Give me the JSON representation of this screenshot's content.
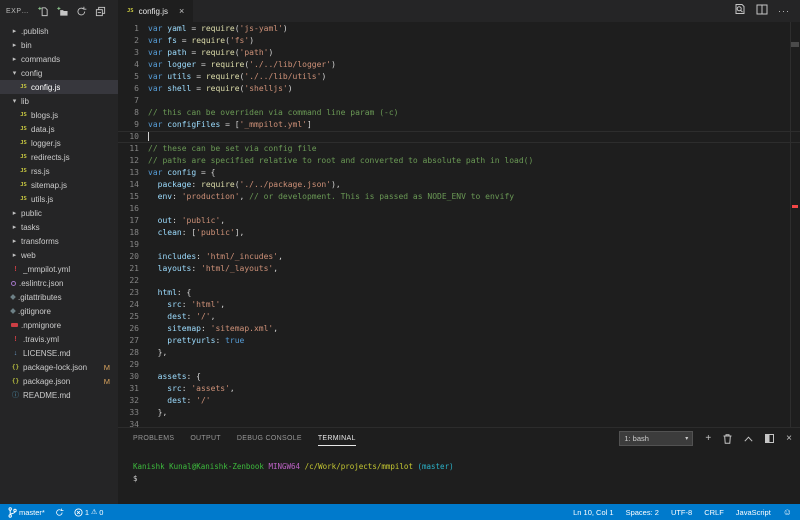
{
  "colors": {
    "accent": "#007acc",
    "editor_bg": "#1e1e1e",
    "sidebar_bg": "#252526",
    "selected_row_bg": "#37373d",
    "keyword": "#569cd6",
    "variable": "#9cdcfe",
    "function": "#dcdcaa",
    "string": "#ce9178",
    "comment": "#6a9955",
    "error_marker": "#f44747",
    "js_icon": "#cbcb41",
    "modified_badge": "#dba55f"
  },
  "explorer": {
    "title": "EXPLORER",
    "toolbar_icons": [
      "new-file-icon",
      "new-folder-icon",
      "refresh-explorer-icon",
      "collapse-folders-icon"
    ],
    "items": [
      {
        "label": ".publish",
        "icon": "folder",
        "arrow": "collapsed",
        "indent": 0
      },
      {
        "label": "bin",
        "icon": "folder",
        "arrow": "collapsed",
        "indent": 0
      },
      {
        "label": "commands",
        "icon": "folder",
        "arrow": "collapsed",
        "indent": 0
      },
      {
        "label": "config",
        "icon": "folder",
        "arrow": "expanded",
        "indent": 0
      },
      {
        "label": "config.js",
        "icon": "js",
        "indent": 1,
        "selected": true
      },
      {
        "label": "lib",
        "icon": "folder",
        "arrow": "expanded",
        "indent": 0
      },
      {
        "label": "blogs.js",
        "icon": "js",
        "indent": 1
      },
      {
        "label": "data.js",
        "icon": "js",
        "indent": 1
      },
      {
        "label": "logger.js",
        "icon": "js",
        "indent": 1
      },
      {
        "label": "redirects.js",
        "icon": "js",
        "indent": 1
      },
      {
        "label": "rss.js",
        "icon": "js",
        "indent": 1
      },
      {
        "label": "sitemap.js",
        "icon": "js",
        "indent": 1
      },
      {
        "label": "utils.js",
        "icon": "js",
        "indent": 1
      },
      {
        "label": "public",
        "icon": "folder",
        "arrow": "collapsed",
        "indent": 0
      },
      {
        "label": "tasks",
        "icon": "folder",
        "arrow": "collapsed",
        "indent": 0
      },
      {
        "label": "transforms",
        "icon": "folder",
        "arrow": "collapsed",
        "indent": 0
      },
      {
        "label": "web",
        "icon": "folder",
        "arrow": "collapsed",
        "indent": 0
      },
      {
        "label": "_mmpilot.yml",
        "icon": "yml",
        "indent": 0
      },
      {
        "label": ".eslintrc.json",
        "icon": "eslint",
        "indent": 0
      },
      {
        "label": ".gitattributes",
        "icon": "git",
        "indent": 0
      },
      {
        "label": ".gitignore",
        "icon": "git",
        "indent": 0
      },
      {
        "label": ".npmignore",
        "icon": "npm",
        "indent": 0
      },
      {
        "label": ".travis.yml",
        "icon": "yml",
        "indent": 0
      },
      {
        "label": "LICENSE.md",
        "icon": "license",
        "indent": 0
      },
      {
        "label": "package-lock.json",
        "icon": "json",
        "indent": 0,
        "badge": "M"
      },
      {
        "label": "package.json",
        "icon": "json",
        "indent": 0,
        "badge": "M"
      },
      {
        "label": "README.md",
        "icon": "info",
        "indent": 0
      }
    ]
  },
  "editor": {
    "tab": {
      "label": "config.js",
      "icon": "js",
      "close_glyph": "×"
    },
    "action_icons": [
      "open-preview-icon",
      "split-editor-icon",
      "more-actions-icon"
    ],
    "cursor": {
      "line": 10,
      "col": 1
    },
    "lines": [
      {
        "n": 1,
        "t": [
          [
            "k",
            "var"
          ],
          [
            "d",
            " "
          ],
          [
            "v",
            "yaml"
          ],
          [
            "d",
            " = "
          ],
          [
            "f",
            "require"
          ],
          [
            "d",
            "("
          ],
          [
            "s",
            "'js-yaml'"
          ],
          [
            "d",
            ")"
          ]
        ]
      },
      {
        "n": 2,
        "t": [
          [
            "k",
            "var"
          ],
          [
            "d",
            " "
          ],
          [
            "v",
            "fs"
          ],
          [
            "d",
            " = "
          ],
          [
            "f",
            "require"
          ],
          [
            "d",
            "("
          ],
          [
            "s",
            "'fs'"
          ],
          [
            "d",
            ")"
          ]
        ]
      },
      {
        "n": 3,
        "t": [
          [
            "k",
            "var"
          ],
          [
            "d",
            " "
          ],
          [
            "v",
            "path"
          ],
          [
            "d",
            " = "
          ],
          [
            "f",
            "require"
          ],
          [
            "d",
            "("
          ],
          [
            "s",
            "'path'"
          ],
          [
            "d",
            ")"
          ]
        ]
      },
      {
        "n": 4,
        "t": [
          [
            "k",
            "var"
          ],
          [
            "d",
            " "
          ],
          [
            "v",
            "logger"
          ],
          [
            "d",
            " = "
          ],
          [
            "f",
            "require"
          ],
          [
            "d",
            "("
          ],
          [
            "s",
            "'./../lib/logger'"
          ],
          [
            "d",
            ")"
          ]
        ]
      },
      {
        "n": 5,
        "t": [
          [
            "k",
            "var"
          ],
          [
            "d",
            " "
          ],
          [
            "v",
            "utils"
          ],
          [
            "d",
            " = "
          ],
          [
            "f",
            "require"
          ],
          [
            "d",
            "("
          ],
          [
            "s",
            "'./../lib/utils'"
          ],
          [
            "d",
            ")"
          ]
        ]
      },
      {
        "n": 6,
        "t": [
          [
            "k",
            "var"
          ],
          [
            "d",
            " "
          ],
          [
            "v",
            "shell"
          ],
          [
            "d",
            " = "
          ],
          [
            "f",
            "require"
          ],
          [
            "d",
            "("
          ],
          [
            "s",
            "'shelljs'"
          ],
          [
            "d",
            ")"
          ]
        ]
      },
      {
        "n": 7,
        "t": []
      },
      {
        "n": 8,
        "t": [
          [
            "c",
            "// this can be overriden via command line param (-c)"
          ]
        ]
      },
      {
        "n": 9,
        "t": [
          [
            "k",
            "var"
          ],
          [
            "d",
            " "
          ],
          [
            "v",
            "configFiles"
          ],
          [
            "d",
            " = ["
          ],
          [
            "s",
            "'_mmpilot.yml'"
          ],
          [
            "d",
            "]"
          ]
        ]
      },
      {
        "n": 10,
        "t": [],
        "cur": true
      },
      {
        "n": 11,
        "t": [
          [
            "c",
            "// these can be set via config file"
          ]
        ]
      },
      {
        "n": 12,
        "t": [
          [
            "c",
            "// paths are specified relative to root and converted to absolute path in load()"
          ]
        ]
      },
      {
        "n": 13,
        "t": [
          [
            "k",
            "var"
          ],
          [
            "d",
            " "
          ],
          [
            "v",
            "config"
          ],
          [
            "d",
            " = {"
          ]
        ]
      },
      {
        "n": 14,
        "t": [
          [
            "d",
            "  "
          ],
          [
            "v",
            "package"
          ],
          [
            "d",
            ": "
          ],
          [
            "f",
            "require"
          ],
          [
            "d",
            "("
          ],
          [
            "s",
            "'./../package.json'"
          ],
          [
            "d",
            "),"
          ]
        ]
      },
      {
        "n": 15,
        "t": [
          [
            "d",
            "  "
          ],
          [
            "v",
            "env"
          ],
          [
            "d",
            ": "
          ],
          [
            "s",
            "'production'"
          ],
          [
            "d",
            ", "
          ],
          [
            "c",
            "// or development. This is passed as NODE_ENV to envify"
          ]
        ]
      },
      {
        "n": 16,
        "t": []
      },
      {
        "n": 17,
        "t": [
          [
            "d",
            "  "
          ],
          [
            "v",
            "out"
          ],
          [
            "d",
            ": "
          ],
          [
            "s",
            "'public'"
          ],
          [
            "d",
            ","
          ]
        ]
      },
      {
        "n": 18,
        "t": [
          [
            "d",
            "  "
          ],
          [
            "v",
            "clean"
          ],
          [
            "d",
            ": ["
          ],
          [
            "s",
            "'public'"
          ],
          [
            "d",
            "],"
          ]
        ]
      },
      {
        "n": 19,
        "t": []
      },
      {
        "n": 20,
        "t": [
          [
            "d",
            "  "
          ],
          [
            "v",
            "includes"
          ],
          [
            "d",
            ": "
          ],
          [
            "s",
            "'html/_incudes'"
          ],
          [
            "d",
            ","
          ]
        ]
      },
      {
        "n": 21,
        "t": [
          [
            "d",
            "  "
          ],
          [
            "v",
            "layouts"
          ],
          [
            "d",
            ": "
          ],
          [
            "s",
            "'html/_layouts'"
          ],
          [
            "d",
            ","
          ]
        ]
      },
      {
        "n": 22,
        "t": []
      },
      {
        "n": 23,
        "t": [
          [
            "d",
            "  "
          ],
          [
            "v",
            "html"
          ],
          [
            "d",
            ": {"
          ]
        ]
      },
      {
        "n": 24,
        "t": [
          [
            "d",
            "    "
          ],
          [
            "v",
            "src"
          ],
          [
            "d",
            ": "
          ],
          [
            "s",
            "'html'"
          ],
          [
            "d",
            ","
          ]
        ]
      },
      {
        "n": 25,
        "t": [
          [
            "d",
            "    "
          ],
          [
            "v",
            "dest"
          ],
          [
            "d",
            ": "
          ],
          [
            "s",
            "'/'"
          ],
          [
            "d",
            ","
          ]
        ]
      },
      {
        "n": 26,
        "t": [
          [
            "d",
            "    "
          ],
          [
            "v",
            "sitemap"
          ],
          [
            "d",
            ": "
          ],
          [
            "s",
            "'sitemap.xml'"
          ],
          [
            "d",
            ","
          ]
        ]
      },
      {
        "n": 27,
        "t": [
          [
            "d",
            "    "
          ],
          [
            "v",
            "prettyurls"
          ],
          [
            "d",
            ": "
          ],
          [
            "k",
            "true"
          ]
        ]
      },
      {
        "n": 28,
        "t": [
          [
            "d",
            "  },"
          ]
        ]
      },
      {
        "n": 29,
        "t": []
      },
      {
        "n": 30,
        "t": [
          [
            "d",
            "  "
          ],
          [
            "v",
            "assets"
          ],
          [
            "d",
            ": {"
          ]
        ]
      },
      {
        "n": 31,
        "t": [
          [
            "d",
            "    "
          ],
          [
            "v",
            "src"
          ],
          [
            "d",
            ": "
          ],
          [
            "s",
            "'assets'"
          ],
          [
            "d",
            ","
          ]
        ]
      },
      {
        "n": 32,
        "t": [
          [
            "d",
            "    "
          ],
          [
            "v",
            "dest"
          ],
          [
            "d",
            ": "
          ],
          [
            "s",
            "'/'"
          ]
        ]
      },
      {
        "n": 33,
        "t": [
          [
            "d",
            "  },"
          ]
        ]
      },
      {
        "n": 34,
        "t": []
      }
    ]
  },
  "panel": {
    "tabs": [
      {
        "label": "PROBLEMS",
        "active": false
      },
      {
        "label": "OUTPUT",
        "active": false
      },
      {
        "label": "DEBUG CONSOLE",
        "active": false
      },
      {
        "label": "TERMINAL",
        "active": true
      }
    ],
    "shell_selector": {
      "value": "1: bash",
      "caret": "▾"
    },
    "action_icons": [
      "new-terminal-icon",
      "kill-terminal-icon",
      "maximize-panel-icon",
      "split-terminal-icon",
      "close-panel-icon"
    ],
    "terminal": {
      "prompt_line": [
        [
          "green",
          "Kanishk Kunal@Kanishk-Zenbook"
        ],
        [
          "plain",
          " "
        ],
        [
          "magenta",
          "MINGW64"
        ],
        [
          "plain",
          " "
        ],
        [
          "yellow",
          "/c/Work/projects/mmpilot"
        ],
        [
          "plain",
          " "
        ],
        [
          "cyan",
          "(master)"
        ]
      ],
      "input_line": "$"
    }
  },
  "statusbar": {
    "branch": "master*",
    "errors": "1",
    "warnings": "0",
    "line_col": "Ln 10, Col 1",
    "indentation": "Spaces: 2",
    "encoding": "UTF-8",
    "eol": "CRLF",
    "language": "JavaScript"
  }
}
